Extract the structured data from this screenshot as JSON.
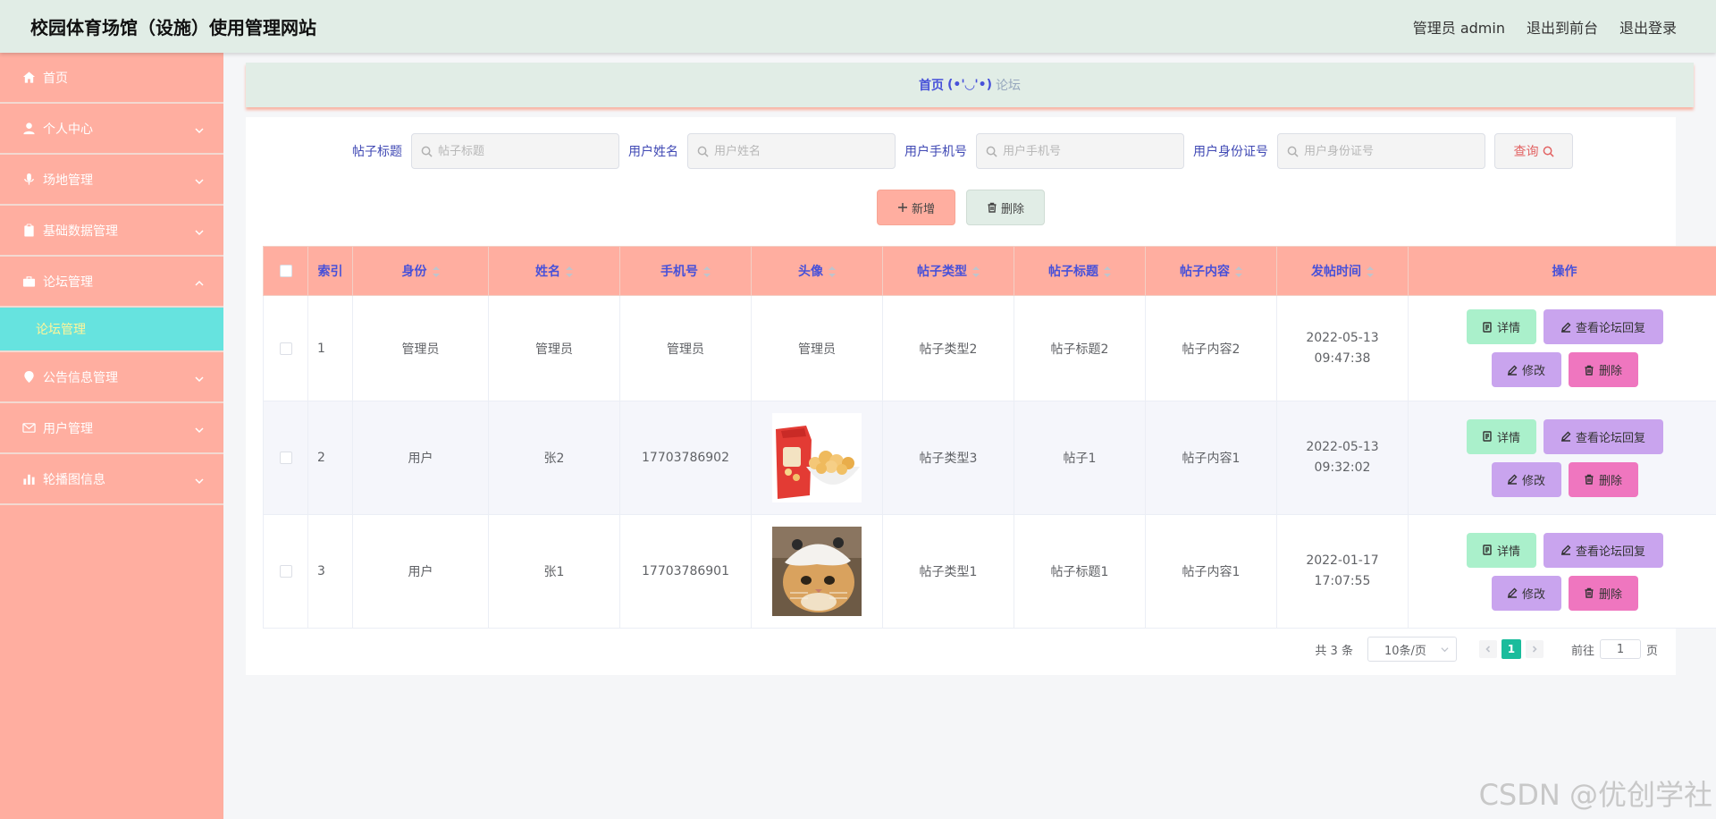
{
  "header": {
    "title": "校园体育场馆（设施）使用管理网站",
    "user": "管理员 admin",
    "front": "退出到前台",
    "logout": "退出登录"
  },
  "sidebar": {
    "items": [
      {
        "label": "首页",
        "icon": "home-icon"
      },
      {
        "label": "个人中心",
        "icon": "user-icon"
      },
      {
        "label": "场地管理",
        "icon": "microphone-icon"
      },
      {
        "label": "基础数据管理",
        "icon": "clipboard-icon"
      },
      {
        "label": "论坛管理",
        "icon": "briefcase-icon"
      },
      {
        "label": "公告信息管理",
        "icon": "location-icon"
      },
      {
        "label": "用户管理",
        "icon": "mail-icon"
      },
      {
        "label": "轮播图信息",
        "icon": "bar-chart-icon"
      }
    ],
    "sub": {
      "label": "论坛管理"
    }
  },
  "breadcrumb": {
    "home": "首页",
    "sep": "(•'◡'•)",
    "current": "论坛"
  },
  "search": {
    "title": {
      "label": "帖子标题",
      "placeholder": "帖子标题"
    },
    "name": {
      "label": "用户姓名",
      "placeholder": "用户姓名"
    },
    "phone": {
      "label": "用户手机号",
      "placeholder": "用户手机号"
    },
    "idcard": {
      "label": "用户身份证号",
      "placeholder": "用户身份证号"
    },
    "query_label": "查询"
  },
  "actions": {
    "add": "新增",
    "delete": "删除"
  },
  "table": {
    "headers": {
      "index": "索引",
      "role": "身份",
      "name": "姓名",
      "phone": "手机号",
      "avatar": "头像",
      "type": "帖子类型",
      "title": "帖子标题",
      "content": "帖子内容",
      "time": "发帖时间",
      "ops": "操作"
    },
    "rows": [
      {
        "index": "1",
        "role": "管理员",
        "name": "管理员",
        "phone": "管理员",
        "avatar_text": "管理员",
        "type": "帖子类型2",
        "title": "帖子标题2",
        "content": "帖子内容2",
        "time": "2022-05-13 09:47:38"
      },
      {
        "index": "2",
        "role": "用户",
        "name": "张2",
        "phone": "17703786902",
        "avatar_text": "",
        "type": "帖子类型3",
        "title": "帖子1",
        "content": "帖子内容1",
        "time": "2022-05-13 09:32:02"
      },
      {
        "index": "3",
        "role": "用户",
        "name": "张1",
        "phone": "17703786901",
        "avatar_text": "",
        "type": "帖子类型1",
        "title": "帖子标题1",
        "content": "帖子内容1",
        "time": "2022-01-17 17:07:55"
      }
    ],
    "op_labels": {
      "detail": "详情",
      "reply": "查看论坛回复",
      "edit": "修改",
      "delete": "删除"
    }
  },
  "pager": {
    "total": "共 3 条",
    "size": "10条/页",
    "current": "1",
    "goto_prefix": "前往",
    "goto_value": "1",
    "goto_suffix": "页"
  },
  "watermark": "CSDN @优创学社"
}
